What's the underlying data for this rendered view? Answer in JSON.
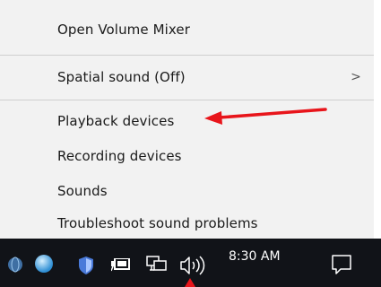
{
  "menu": {
    "items": [
      {
        "label": "Open Volume Mixer"
      },
      {
        "label": "Spatial sound (Off)",
        "has_submenu": true
      },
      {
        "label": "Playback devices"
      },
      {
        "label": "Recording devices"
      },
      {
        "label": "Sounds"
      },
      {
        "label": "Troubleshoot sound problems"
      }
    ],
    "submenu_indicator": ">"
  },
  "taskbar": {
    "time": "8:30 AM",
    "icons": [
      "app-icon-globe",
      "app-icon-shield",
      "battery-icon",
      "network-icon",
      "volume-icon",
      "notification-icon"
    ]
  },
  "colors": {
    "menu_bg": "#f2f2f2",
    "taskbar_bg": "#111318",
    "annotation_arrow": "#e8151b"
  }
}
